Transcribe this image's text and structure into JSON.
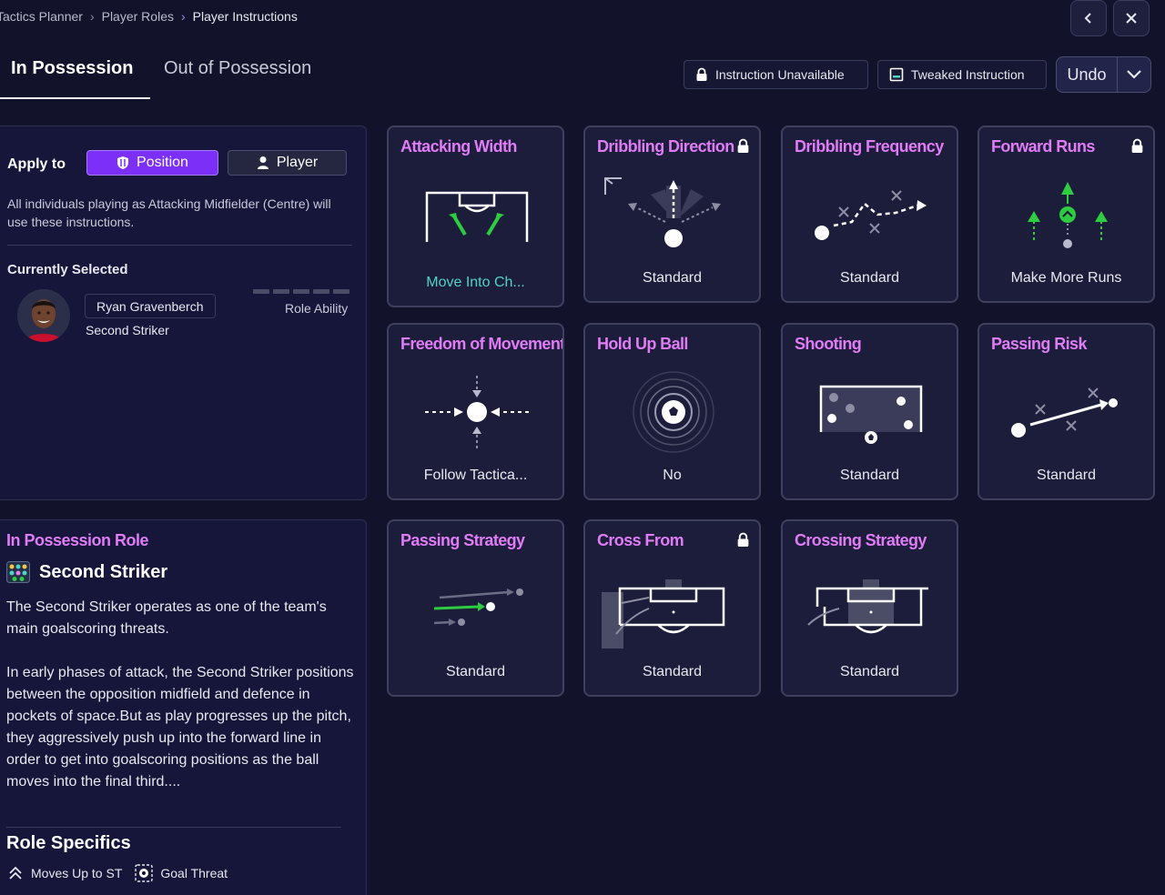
{
  "breadcrumb": {
    "items": [
      "Tactics Planner",
      "Player Roles",
      "Player Instructions"
    ]
  },
  "tabs": {
    "in_possession": "In Possession",
    "out_of_possession": "Out of Possession"
  },
  "legend": {
    "unavailable": "Instruction Unavailable",
    "tweaked": "Tweaked Instruction"
  },
  "undo": {
    "label": "Undo"
  },
  "apply": {
    "label": "Apply to",
    "position": "Position",
    "player": "Player",
    "description": "All individuals playing as Attacking Midfielder (Centre) will use these instructions."
  },
  "current": {
    "heading": "Currently Selected",
    "name": "Ryan Gravenberch",
    "role": "Second Striker",
    "ability_label": "Role Ability",
    "ability_level": 0
  },
  "role": {
    "heading": "In Possession Role",
    "name": "Second Striker",
    "para1": "The Second Striker operates as one of the team's main goalscoring threats.",
    "para2": "In early phases of attack, the Second Striker positions between the opposition midfield and defence in pockets of space.But as play progresses up the pitch, they aggressively push up into the forward line in order to get into goalscoring positions as the ball moves into the final third....",
    "specifics_heading": "Role Specifics",
    "specifics": [
      "Moves Up to ST",
      "Goal Threat"
    ]
  },
  "cards": [
    {
      "title": "Attacking Width",
      "value": "Move Into Ch...",
      "locked": false,
      "tweaked": true
    },
    {
      "title": "Dribbling Direction",
      "value": "Standard",
      "locked": true,
      "tweaked": false
    },
    {
      "title": "Dribbling Frequency",
      "value": "Standard",
      "locked": false,
      "tweaked": false
    },
    {
      "title": "Forward Runs",
      "value": "Make More Runs",
      "locked": true,
      "tweaked": false
    },
    {
      "title": "Freedom of Movement",
      "value": "Follow Tactica...",
      "locked": false,
      "tweaked": false
    },
    {
      "title": "Hold Up Ball",
      "value": "No",
      "locked": false,
      "tweaked": false
    },
    {
      "title": "Shooting",
      "value": "Standard",
      "locked": false,
      "tweaked": false
    },
    {
      "title": "Passing Risk",
      "value": "Standard",
      "locked": false,
      "tweaked": false
    },
    {
      "title": "Passing Strategy",
      "value": "Standard",
      "locked": false,
      "tweaked": false
    },
    {
      "title": "Cross From",
      "value": "Standard",
      "locked": true,
      "tweaked": false
    },
    {
      "title": "Crossing Strategy",
      "value": "Standard",
      "locked": false,
      "tweaked": false
    }
  ],
  "colors": {
    "accent": "#7b2ff7",
    "title_pink": "#e07cf5",
    "tweaked_teal": "#4fd4c4",
    "green": "#2ecc40",
    "background": "#12132b"
  },
  "icons": [
    "chevron-left-icon",
    "close-icon",
    "lock-icon",
    "tweaked-icon",
    "chevron-down-icon",
    "shield-icon",
    "person-icon",
    "role-icon",
    "chevrons-up-icon",
    "football-icon"
  ]
}
